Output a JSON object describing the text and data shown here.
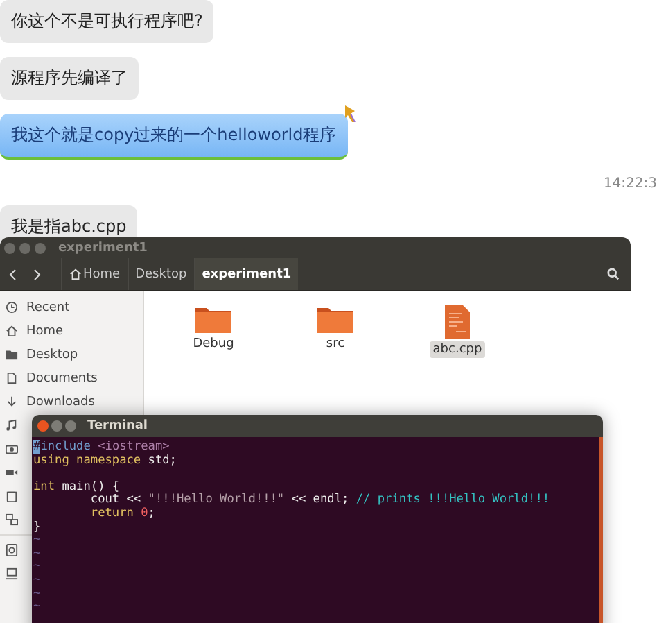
{
  "chat": {
    "messages": [
      {
        "kind": "received",
        "text": "你这个不是可执行程序吧?"
      },
      {
        "kind": "received",
        "text": "源程序先编译了"
      },
      {
        "kind": "sent",
        "text": "我这个就是copy过来的一个helloworld程序"
      },
      {
        "kind": "time",
        "text": "14:22:3"
      },
      {
        "kind": "received",
        "text": "我是指abc.cpp"
      }
    ]
  },
  "file_manager": {
    "title": "experiment1",
    "path": [
      {
        "label": "Home",
        "selected": false
      },
      {
        "label": "Desktop",
        "selected": false
      },
      {
        "label": "experiment1",
        "selected": true
      }
    ],
    "places": [
      {
        "kind": "recent",
        "label": "Recent"
      },
      {
        "kind": "home",
        "label": "Home"
      },
      {
        "kind": "desktop",
        "label": "Desktop"
      },
      {
        "kind": "documents",
        "label": "Documents"
      },
      {
        "kind": "downloads",
        "label": "Downloads"
      },
      {
        "kind": "music"
      },
      {
        "kind": "camera"
      },
      {
        "kind": "video"
      },
      {
        "kind": "trash"
      },
      {
        "kind": "network"
      },
      {
        "kind": "disk"
      },
      {
        "kind": "computer"
      }
    ],
    "files": [
      {
        "kind": "folder",
        "name": "Debug",
        "selected": false
      },
      {
        "kind": "folder",
        "name": "src",
        "selected": false
      },
      {
        "kind": "document",
        "name": "abc.cpp",
        "selected": true
      }
    ]
  },
  "terminal": {
    "title": "Terminal",
    "lines": [
      [
        {
          "kind": "cursor",
          "text": "#"
        },
        {
          "kind": "directive",
          "text": "include "
        },
        {
          "kind": "header",
          "text": "<iostream>"
        }
      ],
      [
        {
          "kind": "keyword",
          "text": "using namespace"
        },
        {
          "kind": "plain",
          "text": " std;"
        }
      ],
      [
        {
          "kind": "keyword",
          "text": "int",
          "spaced": true
        },
        {
          "kind": "plain",
          "text": " main() {"
        }
      ],
      [
        {
          "kind": "plain",
          "text": "        cout << "
        },
        {
          "kind": "string",
          "text": "\"!!!Hello World!!!\""
        },
        {
          "kind": "plain",
          "text": " << endl; "
        },
        {
          "kind": "comment",
          "text": "// prints !!!Hello World!!!"
        }
      ],
      [
        {
          "kind": "keyword",
          "text": "        return "
        },
        {
          "kind": "number",
          "text": "0"
        },
        {
          "kind": "plain",
          "text": ";"
        }
      ],
      [
        {
          "kind": "plain",
          "text": "}"
        }
      ],
      [
        {
          "kind": "tilde",
          "text": "~"
        }
      ],
      [
        {
          "kind": "tilde",
          "text": "~"
        }
      ],
      [
        {
          "kind": "tilde",
          "text": "~"
        }
      ],
      [
        {
          "kind": "tilde",
          "text": "~"
        }
      ],
      [
        {
          "kind": "tilde",
          "text": "~"
        }
      ],
      [
        {
          "kind": "tilde",
          "text": "~"
        }
      ]
    ]
  }
}
